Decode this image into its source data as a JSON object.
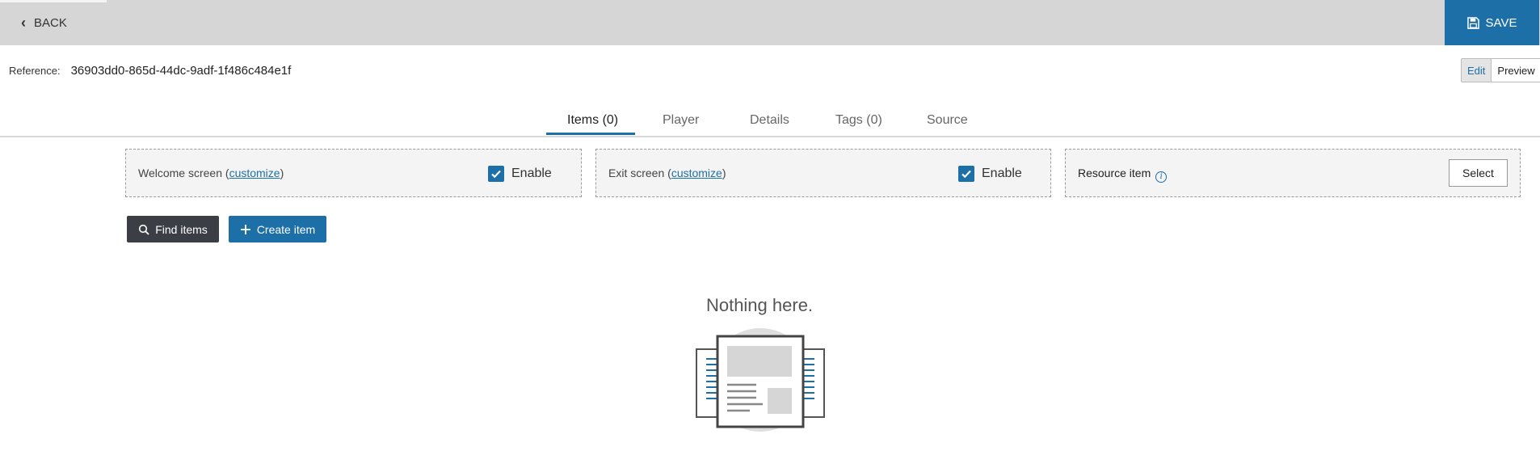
{
  "header": {
    "back_label": "BACK",
    "save_label": "SAVE"
  },
  "reference": {
    "label": "Reference:",
    "value": "36903dd0-865d-44dc-9adf-1f486c484e1f"
  },
  "mode_toggle": {
    "edit_label": "Edit",
    "preview_label": "Preview",
    "selected": "Edit"
  },
  "tabs": [
    {
      "label": "Items (0)",
      "active": true
    },
    {
      "label": "Player",
      "active": false
    },
    {
      "label": "Details",
      "active": false
    },
    {
      "label": "Tags (0)",
      "active": false
    },
    {
      "label": "Source",
      "active": false
    }
  ],
  "panels": {
    "welcome": {
      "label": "Welcome screen (",
      "link": "customize",
      "label_end": ")",
      "enable_label": "Enable",
      "enabled": true
    },
    "exit": {
      "label": "Exit screen (",
      "link": "customize",
      "label_end": ")",
      "enable_label": "Enable",
      "enabled": true
    },
    "resource": {
      "label": "Resource item",
      "select_label": "Select"
    }
  },
  "actions": {
    "find_label": "Find items",
    "create_label": "Create item"
  },
  "empty_state": {
    "title": "Nothing here."
  },
  "colors": {
    "accent": "#1d6fa8",
    "topbar": "#d6d6d6",
    "dark_button": "#3b3e44",
    "panel_bg": "#f4f4f4"
  }
}
